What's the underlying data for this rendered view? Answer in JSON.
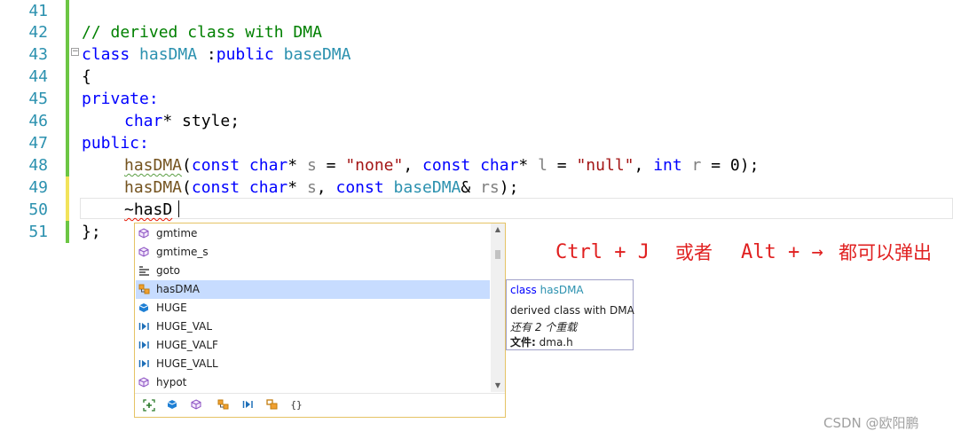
{
  "editor": {
    "line_numbers": [
      "41",
      "42",
      "43",
      "44",
      "45",
      "46",
      "47",
      "48",
      "49",
      "50",
      "51"
    ],
    "line42": "// derived class with DMA",
    "line43": {
      "kw": "class",
      "name": "hasDMA",
      "sep": " :",
      "access": "public",
      "base": "baseDMA"
    },
    "line44": "{",
    "line45": "private:",
    "line46": {
      "type": "char",
      "rest": "* style;"
    },
    "line47": "public:",
    "line48": {
      "fn": "hasDMA",
      "p1": "(",
      "c1": "const",
      "t1": "char",
      "s1": "* ",
      "n1": "s",
      "e1": " = ",
      "v1": "\"none\"",
      "c2": ", ",
      "k2": "const",
      "t2": "char",
      "s2": "* ",
      "n2": "l",
      "e2": " = ",
      "v2": "\"null\"",
      "c3": ", ",
      "t3": "int",
      "n3": "r",
      "e3": " = 0);"
    },
    "line49": {
      "fn": "hasDMA",
      "p1": "(",
      "c1": "const",
      "t1": "char",
      "s1": "* ",
      "n1": "s",
      "c2": ", ",
      "k2": "const",
      "t2": "baseDMA",
      "s2": "& ",
      "n2": "rs",
      "end": ");"
    },
    "line50": "~hasD",
    "line51": "};"
  },
  "completion": {
    "items": [
      {
        "label": "gmtime",
        "icon": "function-icon"
      },
      {
        "label": "gmtime_s",
        "icon": "function-icon"
      },
      {
        "label": "goto",
        "icon": "keyword-icon"
      },
      {
        "label": "hasDMA",
        "icon": "class-icon"
      },
      {
        "label": "HUGE",
        "icon": "variable-icon"
      },
      {
        "label": "HUGE_VAL",
        "icon": "macro-icon"
      },
      {
        "label": "HUGE_VALF",
        "icon": "macro-icon"
      },
      {
        "label": "HUGE_VALL",
        "icon": "macro-icon"
      },
      {
        "label": "hypot",
        "icon": "function-icon"
      }
    ],
    "selected_index": 3,
    "filters": [
      "filter-all-icon",
      "variable-icon",
      "function-icon",
      "class-icon",
      "macro-icon",
      "namespace-icon",
      "braces-icon"
    ]
  },
  "tooltip": {
    "kw": "class",
    "name": "hasDMA",
    "desc": "derived class with DMA",
    "overloads": "还有 2 个重载",
    "file_label": "文件:",
    "file": "dma.h"
  },
  "annotation": {
    "ctrl": "Ctrl + J",
    "or": "或者",
    "alt": "Alt + →",
    "pop": "都可以弹出"
  },
  "watermark": "CSDN @欧阳鹏",
  "colors": {
    "line_number": "#2b91af",
    "keyword": "#0000ff",
    "type": "#2b91af",
    "string": "#a31515",
    "comment": "#008000",
    "annotation": "#e02020",
    "selection": "#c7dcff"
  }
}
